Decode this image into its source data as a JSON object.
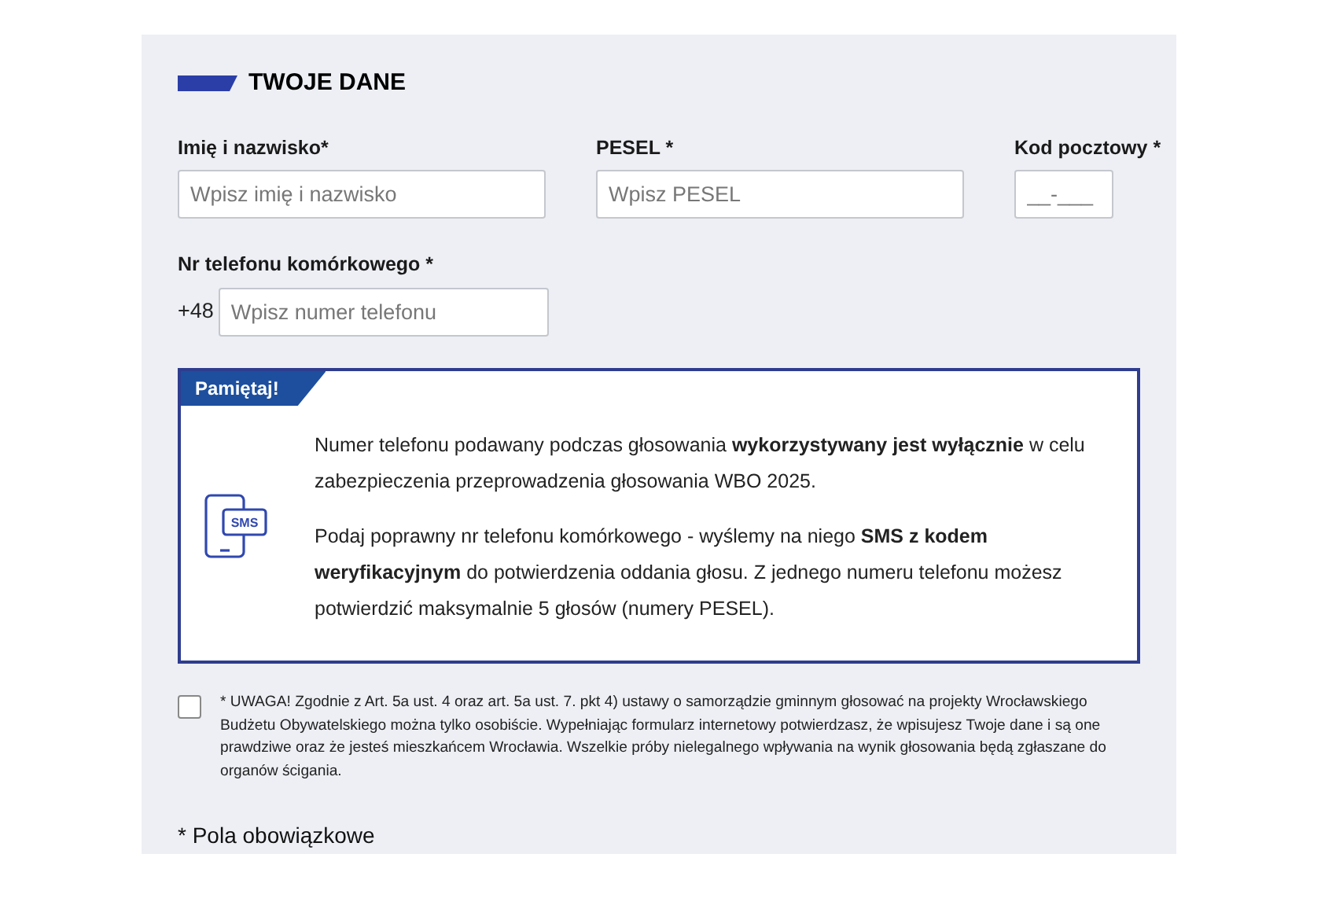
{
  "section": {
    "title": "TWOJE DANE"
  },
  "fields": [
    {
      "label": "Imię i nazwisko*",
      "placeholder": "Wpisz imię i nazwisko",
      "kind": "wide"
    },
    {
      "label": "PESEL *",
      "placeholder": "Wpisz PESEL",
      "kind": "wide"
    },
    {
      "label": "Kod pocztowy *",
      "placeholder": "__-___",
      "kind": "short"
    }
  ],
  "phone": {
    "label": "Nr telefonu komórkowego *",
    "prefix": "+48",
    "placeholder": "Wpisz numer telefonu"
  },
  "notice": {
    "badge": "Pamiętaj!",
    "icon_text": "SMS",
    "paragraphs": [
      "Numer telefonu podawany podczas głosowania **wykorzystywany jest wyłącznie** w celu zabezpieczenia przeprowadzenia głosowania WBO 2025.",
      "Podaj poprawny nr telefonu komórkowego - wyślemy na niego **SMS z kodem weryfikacyjnym** do potwierdzenia oddania głosu. Z jednego numeru telefonu możesz potwierdzić maksymalnie 5 głosów (numery PESEL)."
    ]
  },
  "consent": {
    "checked": false,
    "text": "* UWAGA! Zgodnie z Art. 5a ust. 4 oraz art. 5a ust. 7. pkt 4) ustawy o samorządzie gminnym głosować na projekty Wrocławskiego Budżetu Obywatelskiego można tylko osobiście. Wypełniając formularz internetowy potwierdzasz, że wpisujesz Twoje dane i są one prawdziwe oraz że jesteś mieszkańcem Wrocławia. Wszelkie próby nielegalnego wpływania na wynik głosowania będą zgłaszane do organów ścigania."
  },
  "required_note": "* Pola obowiązkowe"
}
